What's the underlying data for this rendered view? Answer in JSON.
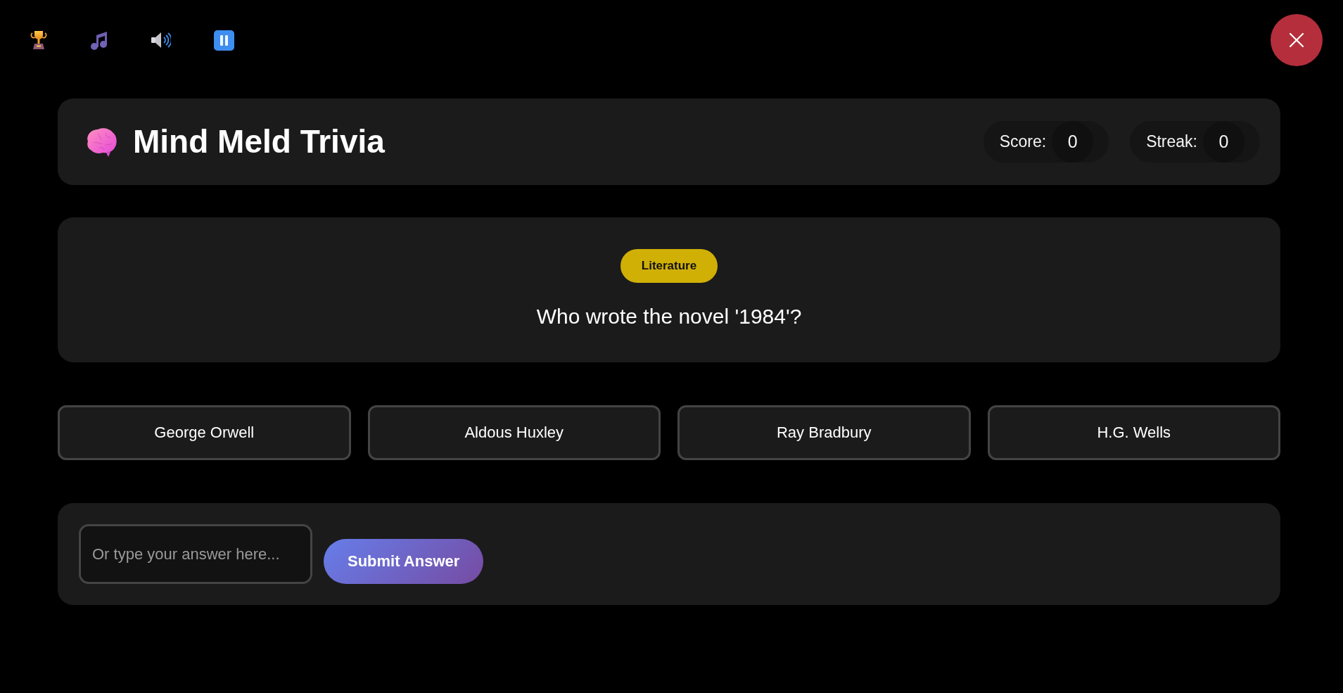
{
  "header": {
    "title": "Mind Meld Trivia",
    "stats": [
      {
        "label": "Score:",
        "value": "0"
      },
      {
        "label": "Streak:",
        "value": "0"
      }
    ]
  },
  "question": {
    "category": "Literature",
    "text": "Who wrote the novel '1984'?"
  },
  "options": [
    {
      "label": "George Orwell",
      "selected": false
    },
    {
      "label": "Aldous Huxley",
      "selected": false
    },
    {
      "label": "Ray Bradbury",
      "selected": false
    },
    {
      "label": "H.G. Wells",
      "selected": false
    }
  ],
  "answer": {
    "placeholder": "Or type your answer here...",
    "submit": "Submit Answer"
  }
}
